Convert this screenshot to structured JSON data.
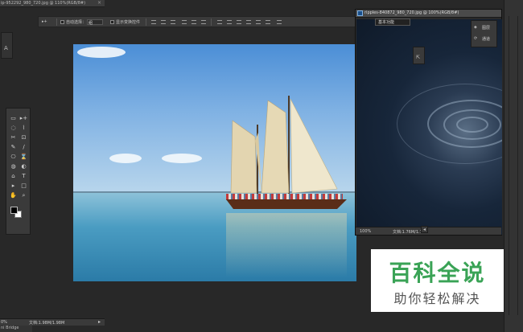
{
  "document_tab": {
    "title": "ip-952292_980_720.jpg @ 110%(RGB/8#)",
    "close": "×"
  },
  "options_bar": {
    "tool_glyph": "▸+",
    "auto_select_label": "自动选择：",
    "auto_select_value": "组",
    "show_transform_label": "显示变换控件"
  },
  "left_panel": {
    "icon": "A"
  },
  "toolbox": {
    "tools": [
      "▭",
      "▸+",
      "◌",
      "⌇",
      "✂",
      "⊡",
      "✎",
      "∕",
      "⎔",
      "⌛",
      "◍",
      "◐",
      "⌂",
      "T",
      "▸",
      "□",
      "✋",
      "⌕"
    ]
  },
  "floating_window": {
    "title": "ripples-840872_980_720.jpg @ 100%(RGB/8#)",
    "workspace_label": "基本功能",
    "panels": [
      {
        "icon": "◈",
        "label": "图层"
      },
      {
        "icon": "⟳",
        "label": "通道"
      }
    ],
    "dock_icon": "⇱",
    "status_zoom": "100%",
    "status_doc": "文档:1.76M/1.76M"
  },
  "status_bar": {
    "zoom": "0%",
    "doc": "文档:1.98M/1.98M",
    "arrow": "▸"
  },
  "bottom_tab": {
    "label": "ni Bridge"
  },
  "side_button": {
    "label": "◂"
  },
  "watermark": {
    "title": "百科全说",
    "subtitle": "助你轻松解决"
  },
  "colors": {
    "accent_green": "#3aa356",
    "panel": "#3a3a3a",
    "canvas_bg": "#282828"
  }
}
